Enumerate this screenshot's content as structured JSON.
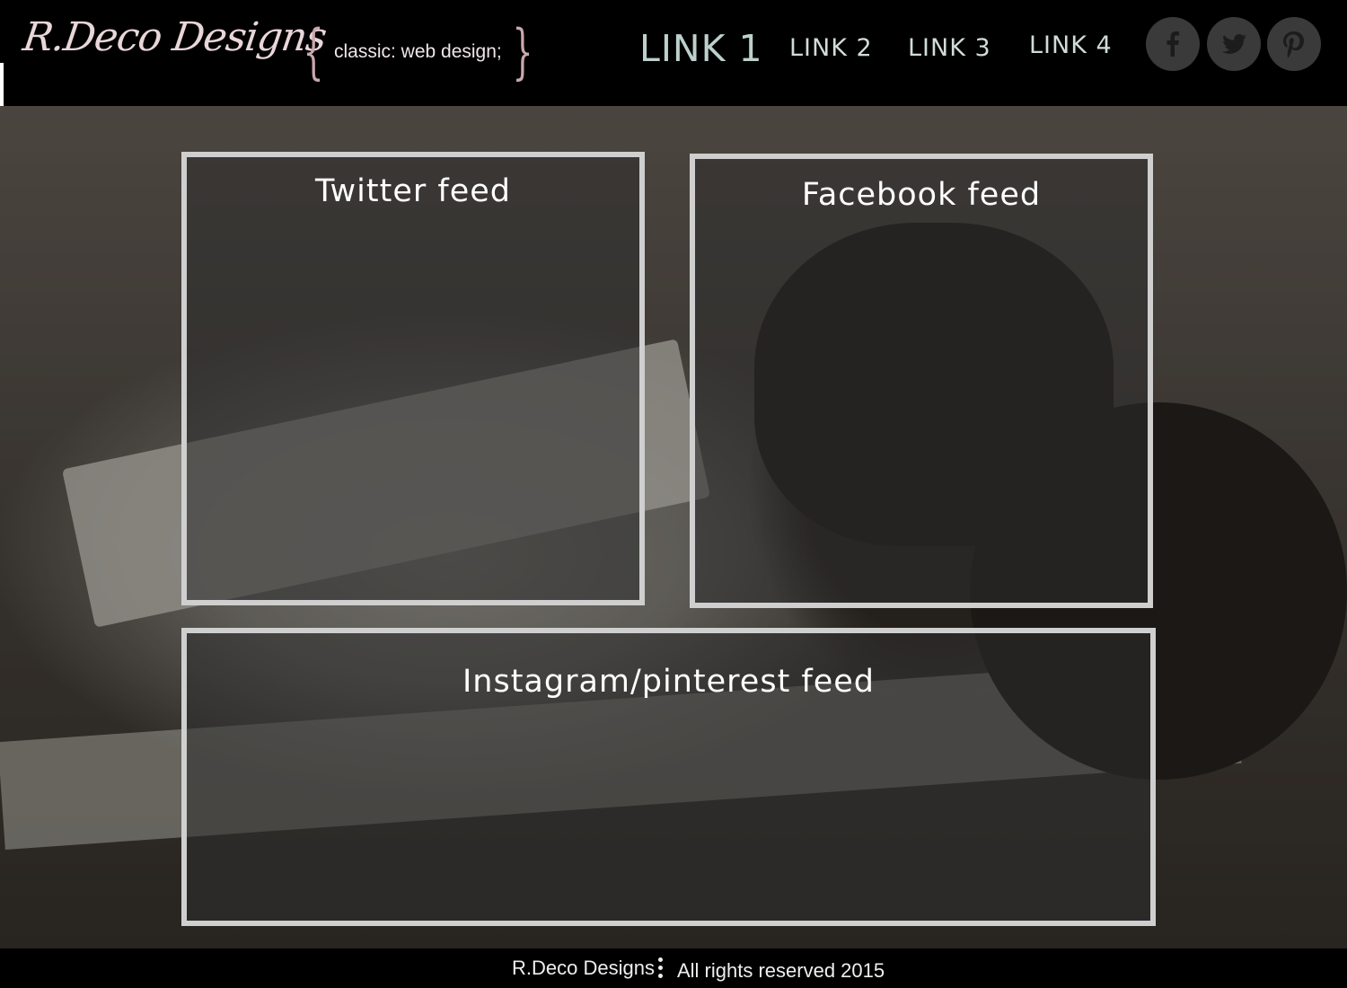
{
  "header": {
    "logo": "R.Deco Designs",
    "tagline": "classic: web design;",
    "nav": [
      {
        "label": "LINK 1",
        "active": true
      },
      {
        "label": "LINK 2",
        "active": false
      },
      {
        "label": "LINK 3",
        "active": false
      },
      {
        "label": "LINK 4",
        "active": false
      }
    ],
    "social": [
      "facebook-icon",
      "twitter-icon",
      "pinterest-icon"
    ]
  },
  "feeds": {
    "twitter": "Twitter feed",
    "facebook": "Facebook feed",
    "instagram": "Instagram/pinterest feed"
  },
  "footer": {
    "company": "R.Deco Designs",
    "rights": "All rights reserved 2015"
  },
  "colors": {
    "background": "#000000",
    "logo": "#e8d6d8",
    "nav": "#d0dcd9",
    "panel_border": "#cfcfcf",
    "social_circle": "#3a3a3a"
  }
}
